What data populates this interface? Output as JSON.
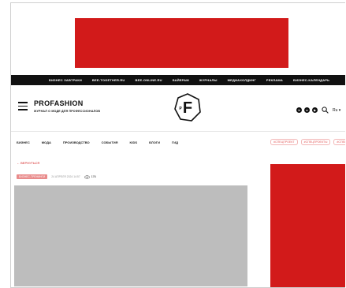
{
  "topnav": {
    "items": [
      "Бизнес завтраки",
      "BEE-TOGETHER.RU",
      "BEE-ONLINE.RU",
      "Байерам",
      "Журналы",
      "Медиахолдинг",
      "Реклама",
      "Бизнес-календарь"
    ]
  },
  "header": {
    "brand_name": "PROFASHION",
    "brand_sub": "ЖУРНАЛ О МОДЕ ДЛЯ ПРОФЕССИОНАЛОВ",
    "logo_letter": "F",
    "logo_small": "P",
    "lang": "Ru"
  },
  "catnav": {
    "items": [
      "Бизнес",
      "Мода",
      "Производство",
      "События",
      "Kids",
      "Блоги",
      "Гид"
    ],
    "pills": [
      "#Спецпроект",
      "#Спецпроекты",
      "#Спецпроект"
    ]
  },
  "article": {
    "back_label": "← Вернуться",
    "tag": "Бизнес-тренинги",
    "date": "24 апреля 2024 14:57",
    "views": "176"
  },
  "colors": {
    "accent": "#d21a1a",
    "banner": "#d21a1a",
    "image_placeholder": "#bdbdbd",
    "topbar": "#111111"
  }
}
